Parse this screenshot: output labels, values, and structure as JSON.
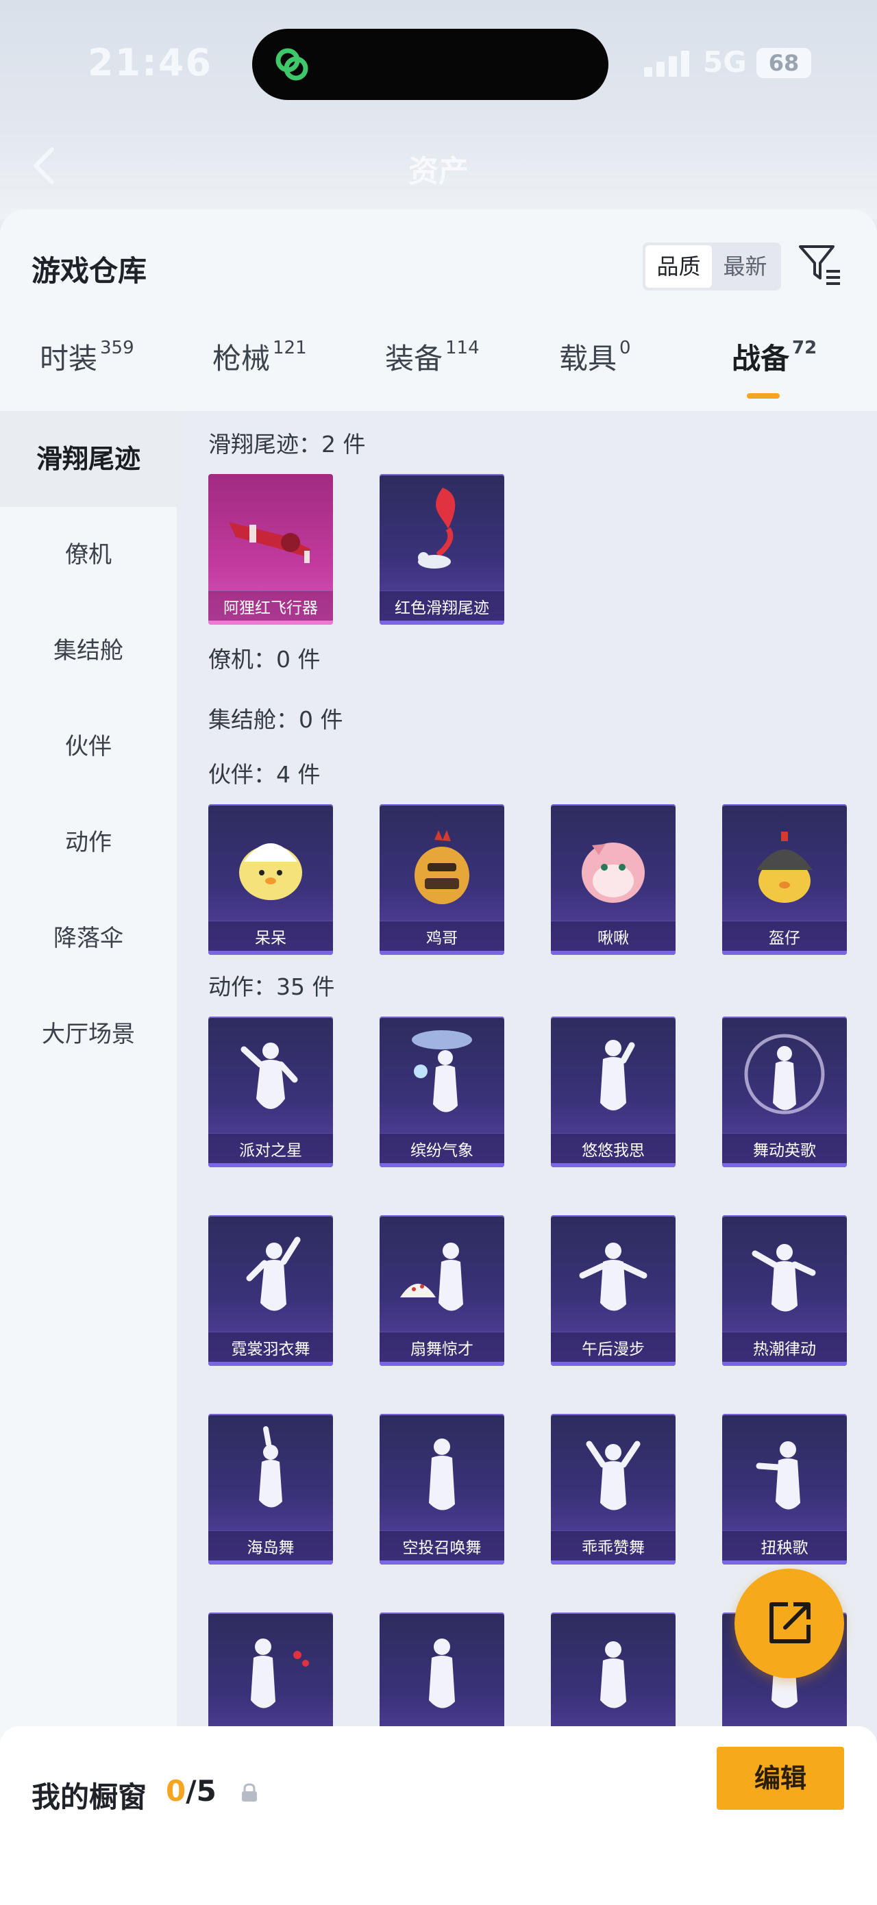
{
  "status": {
    "time": "21:46",
    "network": "5G",
    "battery": "68"
  },
  "header": {
    "title": "资产"
  },
  "warehouse": {
    "title": "游戏仓库",
    "sort_quality": "品质",
    "sort_latest": "最新"
  },
  "tabs": [
    {
      "label": "时装",
      "count": "359"
    },
    {
      "label": "枪械",
      "count": "121"
    },
    {
      "label": "装备",
      "count": "114"
    },
    {
      "label": "载具",
      "count": "0"
    },
    {
      "label": "战备",
      "count": "72"
    }
  ],
  "sidebar": {
    "items": [
      "滑翔尾迹",
      "僚机",
      "集结舱",
      "伙伴",
      "动作",
      "降落伞",
      "大厅场景"
    ]
  },
  "sections": {
    "glide": "滑翔尾迹：2 件",
    "wingman": "僚机：0 件",
    "pod": "集结舱：0 件",
    "partner": "伙伴：4 件",
    "action": "动作：35 件"
  },
  "glide_items": [
    "阿狸红飞行器",
    "红色滑翔尾迹"
  ],
  "partner_items": [
    "呆呆",
    "鸡哥",
    "啾啾",
    "盔仔"
  ],
  "action_items": [
    "派对之星",
    "缤纷气象",
    "悠悠我思",
    "舞动英歌",
    "霓裳羽衣舞",
    "扇舞惊才",
    "午后漫步",
    "热潮律动",
    "海岛舞",
    "空投召唤舞",
    "乖乖赞舞",
    "扭秧歌"
  ],
  "showcase": {
    "title": "我的橱窗",
    "current": "0",
    "total": "/5",
    "edit": "编辑"
  },
  "colors": {
    "accent": "#f6a91b",
    "card_purple": "#3a3279",
    "card_pink": "#c23a9e"
  },
  "icons": [
    "back-icon",
    "filter-icon",
    "lock-icon",
    "share-icon",
    "app-icon"
  ]
}
